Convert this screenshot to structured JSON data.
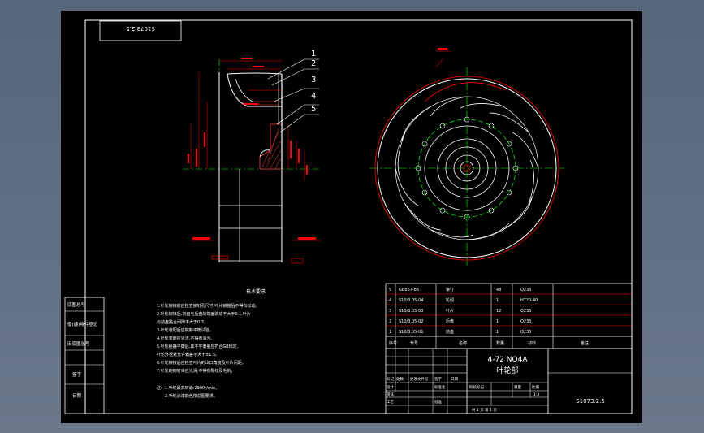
{
  "drawing": {
    "drawing_number": "S1073.2.5",
    "drawing_number_rotated": "S1073.2.5",
    "title_model": "4-72 NO4A",
    "title_name": "叶轮部",
    "scale": "1:3",
    "sheet": "共 1 页 第 1 页"
  },
  "balloons": [
    "1",
    "2",
    "3",
    "4",
    "5"
  ],
  "tech_requirements": {
    "heading": "技术要求",
    "lines": [
      "1.叶轮铆接前应检查铆钉孔尺寸,叶片铆接后不得有松动。",
      "2.叶轮铆接后,前盘与后盘的端面跳动不大于0.1,叶片",
      "  与前盘贴合间隙不大于0.3。",
      "3.叶轮装配后应做静平衡试验。",
      "4.叶轮表面应清洁,不得有油污。",
      "5.叶轮经静平衡后,其不平衡量应符合GB规定,",
      "  叶轮外径处允许偏差不大于±1.5。",
      "6.叶轮铆接后应检查叶片的出口角度及叶片间距。",
      "7.叶轮的铆钉头应光滑,不得有裂纹及毛刺。"
    ],
    "notes_title": "注:",
    "notes": [
      "1.叶轮最高转速:2900r/min。",
      "2.叶轮涂漆颜色按总图要求。"
    ]
  },
  "parts_list": {
    "headers": [
      "序号",
      "代号",
      "名称",
      "数量",
      "材料",
      "备注"
    ],
    "rows": [
      [
        "5",
        "GB867-86",
        "铆钉",
        "48",
        "Q235",
        ""
      ],
      [
        "4",
        "S10/3.05-04",
        "轮毂",
        "1",
        "HT20-40",
        ""
      ],
      [
        "3",
        "S10/3.05-03",
        "叶片",
        "12",
        "Q235",
        ""
      ],
      [
        "2",
        "S10/3.05-02",
        "后盘",
        "1",
        "Q235",
        ""
      ],
      [
        "1",
        "S10/3.05-01",
        "前盘",
        "1",
        "Q235",
        ""
      ]
    ]
  },
  "title_block": {
    "labels": [
      "标记",
      "处数",
      "更改文件号",
      "签字",
      "日期",
      "设计",
      "标准化",
      "审核",
      "工艺",
      "批准",
      "阶段标记",
      "重量",
      "比例"
    ]
  },
  "left_strip": {
    "labels": [
      "底图总号",
      "借(通)用件登记",
      "旧底图总号",
      "签字",
      "日期"
    ]
  },
  "colors": {
    "background": "#000000",
    "outline": "#ffffff",
    "dimension": "#ff0000",
    "centerline": "#00ff00",
    "hatch": "#ff3b3b"
  }
}
